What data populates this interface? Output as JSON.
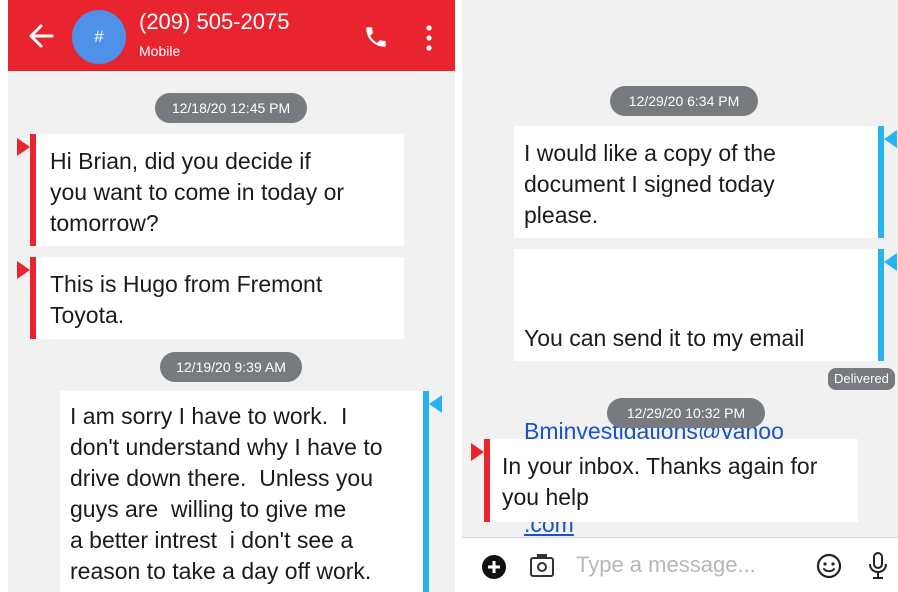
{
  "header": {
    "contact_number": "(209) 505-2075",
    "contact_type": "Mobile",
    "avatar_glyph": "#",
    "icons": [
      "back-arrow-icon",
      "phone-icon",
      "more-vert-icon"
    ]
  },
  "colors": {
    "app_bar": "#e8242f",
    "avatar": "#4f91e8",
    "incoming_accent": "#e8242f",
    "outgoing_accent": "#27b3f0",
    "timestamp_pill": "#777a7e",
    "background": "#f1f1f1"
  },
  "left_panel": {
    "messages": [
      {
        "timestamp": "12/18/20 12:45 PM"
      },
      {
        "direction": "incoming",
        "text": "Hi Brian, did you decide if\nyou want to come in today or\ntomorrow?"
      },
      {
        "direction": "incoming",
        "text": "This is Hugo from Fremont\nToyota."
      },
      {
        "timestamp": "12/19/20 9:39 AM"
      },
      {
        "direction": "outgoing",
        "text": "I am sorry I have to work.  I\ndon't understand why I have to\ndrive down there.  Unless you\nguys are  willing to give me\na better intrest  i don't see a\nreason to take a day off work."
      }
    ]
  },
  "right_panel": {
    "messages": [
      {
        "timestamp": "12/29/20 6:34 PM"
      },
      {
        "direction": "outgoing",
        "text": "I would like a copy of the\ndocument I signed today\nplease."
      },
      {
        "direction": "outgoing",
        "text": "You can send it to my email",
        "link_line1": "Bminvestigations@yahoo",
        "link_line2": ".com"
      },
      {
        "status": "Delivered"
      },
      {
        "timestamp": "12/29/20 10:32 PM"
      },
      {
        "direction": "incoming",
        "text": "In your inbox. Thanks again for\nyou help"
      }
    ],
    "composer": {
      "placeholder": "Type a message...",
      "icons": [
        "add-icon",
        "camera-icon",
        "emoji-icon",
        "microphone-icon"
      ]
    }
  }
}
